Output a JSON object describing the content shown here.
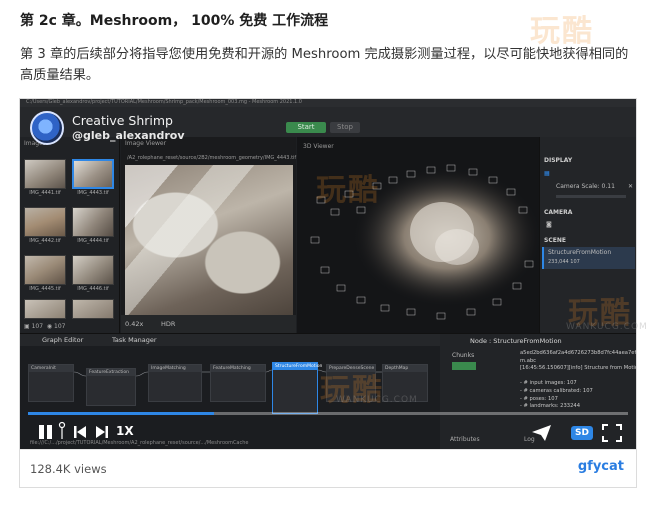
{
  "article": {
    "heading": "第 2c 章。Meshroom， 100% 免费 工作流程",
    "paragraph": "第 3 章的后续部分将指导您使用免费和开源的 Meshroom 完成摄影测量过程，以尽可能快地获得相同的高质量结果。"
  },
  "video": {
    "channel_name": "Creative Shrimp",
    "channel_handle": "@gleb_alexandrov",
    "titlebar": "C:/Users/Gleb_alexandrov/project/TUTORIAL/Meshroom/Shrimp_pack/Meshroom_003.mg - Meshroom 2021.1.0",
    "app": {
      "run_label": "Start",
      "stop_label": "Stop",
      "images_label": "Images",
      "image_viewer_label": "Image Viewer",
      "viewer_path": "/A2_rolephane_reset/source/2B2/meshroom_geometry/IMG_4443.tif",
      "viewer3d_label": "3D Viewer",
      "zoom": "0.42x",
      "hdr": "HDR",
      "image_count": "107",
      "camera_count": "107",
      "thumbnails": [
        {
          "caption": "IMG_4441.tif",
          "selected": false
        },
        {
          "caption": "IMG_4443.tif",
          "selected": true
        },
        {
          "caption": "IMG_4442.tif",
          "selected": false
        },
        {
          "caption": "IMG_4444.tif",
          "selected": false
        },
        {
          "caption": "IMG_4445.tif",
          "selected": false
        },
        {
          "caption": "IMG_4446.tif",
          "selected": false
        }
      ],
      "side": {
        "display_title": "DISPLAY",
        "camera_scale": "Camera Scale: 0.11",
        "camera_title": "CAMERA",
        "scene_title": "SCENE",
        "scene_item": "StructureFromMotion",
        "scene_meta": "233,044  107"
      },
      "graph": {
        "tab_graph_editor": "Graph Editor",
        "tab_task_manager": "Task Manager",
        "nodes": [
          "CameraInit",
          "FeatureExtraction",
          "ImageMatching",
          "FeatureMatching",
          "StructureFromMotion",
          "PrepareDenseScene",
          "DepthMap"
        ]
      },
      "node_panel": {
        "title": "Node : StructureFromMotion",
        "chunks": "Chunks",
        "tab_attributes": "Attributes",
        "tab_log": "Log",
        "log_lines": [
          "a5ed2bd636af2a4d6726273b8d7fc44aea7ef",
          "m.abc",
          "[16:45:56.150607][info] Structure from Motion results:",
          "",
          "- # input images: 107",
          "- # cameras calibrated: 107",
          "- # poses: 107",
          "- # landmarks: 233244"
        ]
      },
      "status_path": "file:///C:/.../project/TUTORIAL/Meshroom/A2_rolephane_reset/source/.../MeshroomCache"
    },
    "player": {
      "speed": "1X",
      "quality": "SD",
      "progress_percent": 31
    }
  },
  "footer": {
    "views": "128.4K views",
    "brand": "gfycat"
  },
  "watermark": {
    "text": "玩酷",
    "sub": "WANKUCG.COM"
  }
}
